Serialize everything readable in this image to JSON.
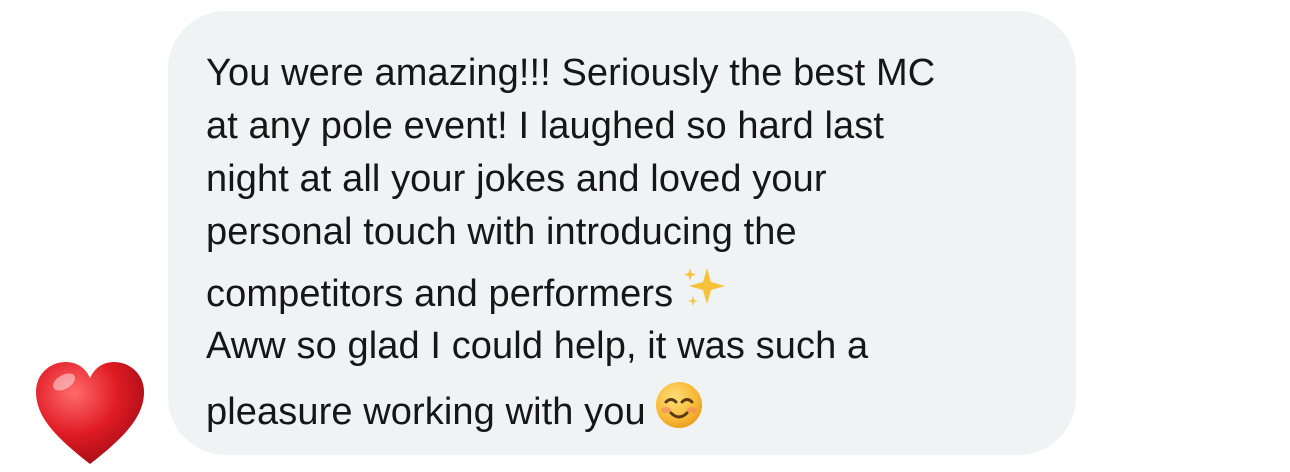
{
  "message": {
    "received_lines": [
      "You were amazing!!! Seriously the best MC",
      "at any pole event! I laughed so hard last",
      "night at all your jokes and loved your",
      "personal touch with introducing the",
      "competitors and performers"
    ],
    "received_trailing_emoji": "sparkles-icon",
    "reply_lines": [
      "Aww so glad I could help, it was such a",
      "pleasure working with you"
    ],
    "reply_trailing_emoji": "smiling-face-icon",
    "reaction": "red-heart-icon"
  },
  "colors": {
    "bubble": "#eff3f4",
    "text": "#161616",
    "heart": "#e01b24",
    "sparkles": "#f6c23a",
    "smiley": "#f7b733"
  }
}
